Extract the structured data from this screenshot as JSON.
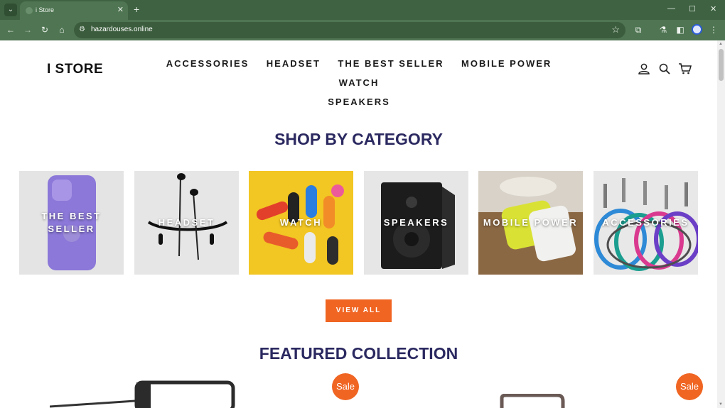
{
  "browser": {
    "tab_title": "i Store",
    "url": "hazardouses.online"
  },
  "header": {
    "logo": "I STORE",
    "nav": [
      "ACCESSORIES",
      "HEADSET",
      "THE BEST SELLER",
      "MOBILE POWER",
      "WATCH",
      "SPEAKERS"
    ]
  },
  "shop_by_category": {
    "title": "SHOP BY CATEGORY",
    "categories": [
      "THE BEST SELLER",
      "HEADSET",
      "WATCH",
      "SPEAKERS",
      "MOBILE POWER",
      "ACCESSORIES"
    ],
    "view_all": "VIEW ALL"
  },
  "featured": {
    "title": "FEATURED COLLECTION",
    "badges": [
      "Sale",
      "Sale"
    ]
  },
  "colors": {
    "accent": "#f06522",
    "title": "#2b2960",
    "chrome": "#4f7552"
  }
}
